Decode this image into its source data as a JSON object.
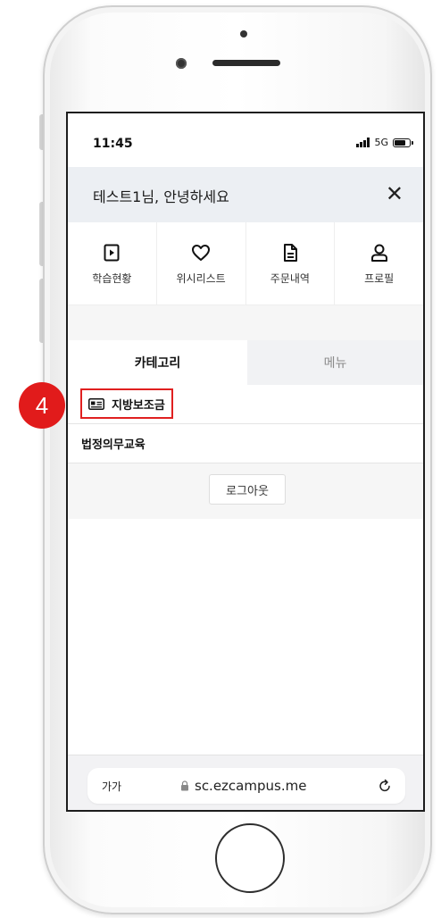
{
  "status_bar": {
    "time": "11:45",
    "network": "5G",
    "battery_level": 0.75
  },
  "greeting": {
    "text": "테스트1님, 안녕하세요",
    "close_icon": "close-icon"
  },
  "quick_menu": [
    {
      "label": "학습현황",
      "icon": "play-square-icon"
    },
    {
      "label": "위시리스트",
      "icon": "heart-icon"
    },
    {
      "label": "주문내역",
      "icon": "document-icon"
    },
    {
      "label": "프로필",
      "icon": "user-icon"
    }
  ],
  "tabs": [
    {
      "label": "카테고리",
      "active": true
    },
    {
      "label": "메뉴",
      "active": false
    }
  ],
  "categories": [
    {
      "label": "지방보조금",
      "icon": "id-card-icon"
    },
    {
      "label": "법정의무교육"
    }
  ],
  "logout": {
    "label": "로그아웃"
  },
  "browser": {
    "aa_label": "가가",
    "url": "sc.ezcampus.me"
  },
  "annotation": {
    "step": "4",
    "color": "#e11b1b"
  }
}
